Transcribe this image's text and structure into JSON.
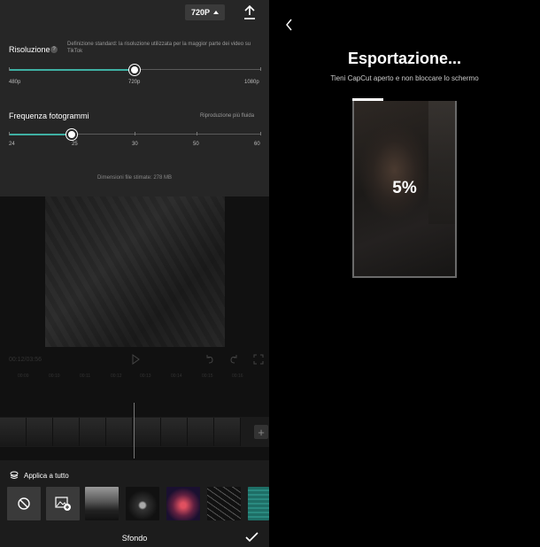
{
  "settings": {
    "resolution_button": "720P",
    "resolution": {
      "label": "Risoluzione",
      "description": "Definizione standard: la risoluzione utilizzata per la maggior parte dei video su TikTok",
      "ticks": [
        "480p",
        "720p",
        "1080p"
      ],
      "selected_fraction": 0.5
    },
    "framerate": {
      "label": "Frequenza fotogrammi",
      "description": "Riproduzione più fluida",
      "ticks": [
        "24",
        "25",
        "30",
        "50",
        "60"
      ],
      "selected_fraction": 0.25
    },
    "file_size": "Dimensioni file stimate: 278 MB",
    "accent_color": "#3fb0a3"
  },
  "editor": {
    "time": "00:12/03:56",
    "ruler": [
      "00:09",
      "00:10",
      "00:11",
      "00:12",
      "00:13",
      "00:14",
      "00:15",
      "00:16"
    ]
  },
  "background_panel": {
    "apply_all": "Applica a tutto",
    "title": "Sfondo",
    "icons": [
      "layers-icon",
      "no-background-icon",
      "add-image-icon",
      "checkmark-icon"
    ]
  },
  "export": {
    "title": "Esportazione...",
    "subtitle": "Tieni CapCut aperto e non bloccare lo schermo",
    "percent": "5%",
    "progress": 0.3
  }
}
